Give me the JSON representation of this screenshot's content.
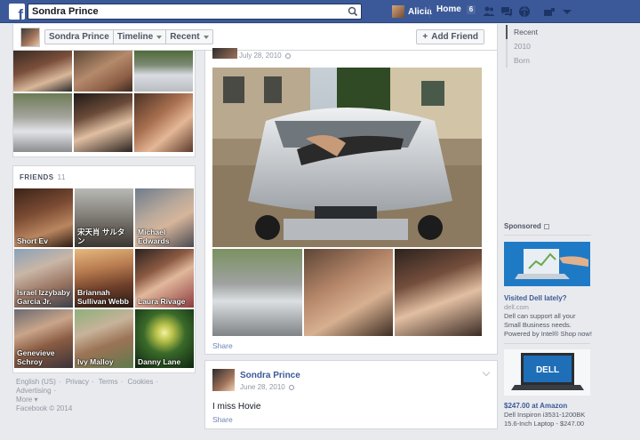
{
  "topbar": {
    "logo": "f",
    "search_value": "Sondra Prince",
    "user_name": "Alicia",
    "home_label": "Home",
    "home_count": "6",
    "icons": [
      "friend-requests-icon",
      "messages-icon",
      "notifications-icon",
      "privacy-shortcuts-icon",
      "account-menu-icon"
    ]
  },
  "timeline_header": {
    "name": "Sondra Prince",
    "tab_timeline": "Timeline",
    "tab_recent": "Recent",
    "add_friend": "Add Friend"
  },
  "friends": {
    "title": "FRIENDS",
    "count": "11",
    "items": [
      {
        "name": "Short Ev"
      },
      {
        "name": "宋天肖 サルタン"
      },
      {
        "name": "Michael Edwards"
      },
      {
        "name": "Israel Izzybaby Garcia Jr."
      },
      {
        "name": "Briannah Sullivan Webb"
      },
      {
        "name": "Laura Rivage"
      },
      {
        "name": "Genevieve Schroy"
      },
      {
        "name": "Ivy Malloy"
      },
      {
        "name": "Danny Lane"
      }
    ]
  },
  "footer": {
    "links": [
      "English (US)",
      "·",
      "Privacy",
      "·",
      "Terms",
      "·",
      "Cookies",
      "·",
      "Advertising",
      "·"
    ],
    "more": "More",
    "copyright": "Facebook © 2014"
  },
  "post1": {
    "date": "July 28, 2010",
    "share": "Share"
  },
  "post2": {
    "name": "Sondra Prince",
    "date": "June 28, 2010",
    "text": "I miss Hovie",
    "share": "Share"
  },
  "scrubber": {
    "items": [
      "Recent",
      "2010",
      "Born"
    ]
  },
  "sponsored": {
    "title": "Sponsored",
    "ad1": {
      "title": "Visited Dell lately?",
      "url": "dell.com",
      "body": "Dell can support all your Small Business needs. Powered by Intel® Shop now!"
    },
    "ad2": {
      "title": "$247.00 at Amazon",
      "body": "Dell Inspiron i3531-1200BK 15.6-Inch Laptop - $247.00",
      "logo": "DELL"
    }
  },
  "colors": {
    "brand_blue": "#3b5998",
    "page_bg": "#e9eaed",
    "link_blue": "#3b5998",
    "muted_text": "#9197a3"
  }
}
